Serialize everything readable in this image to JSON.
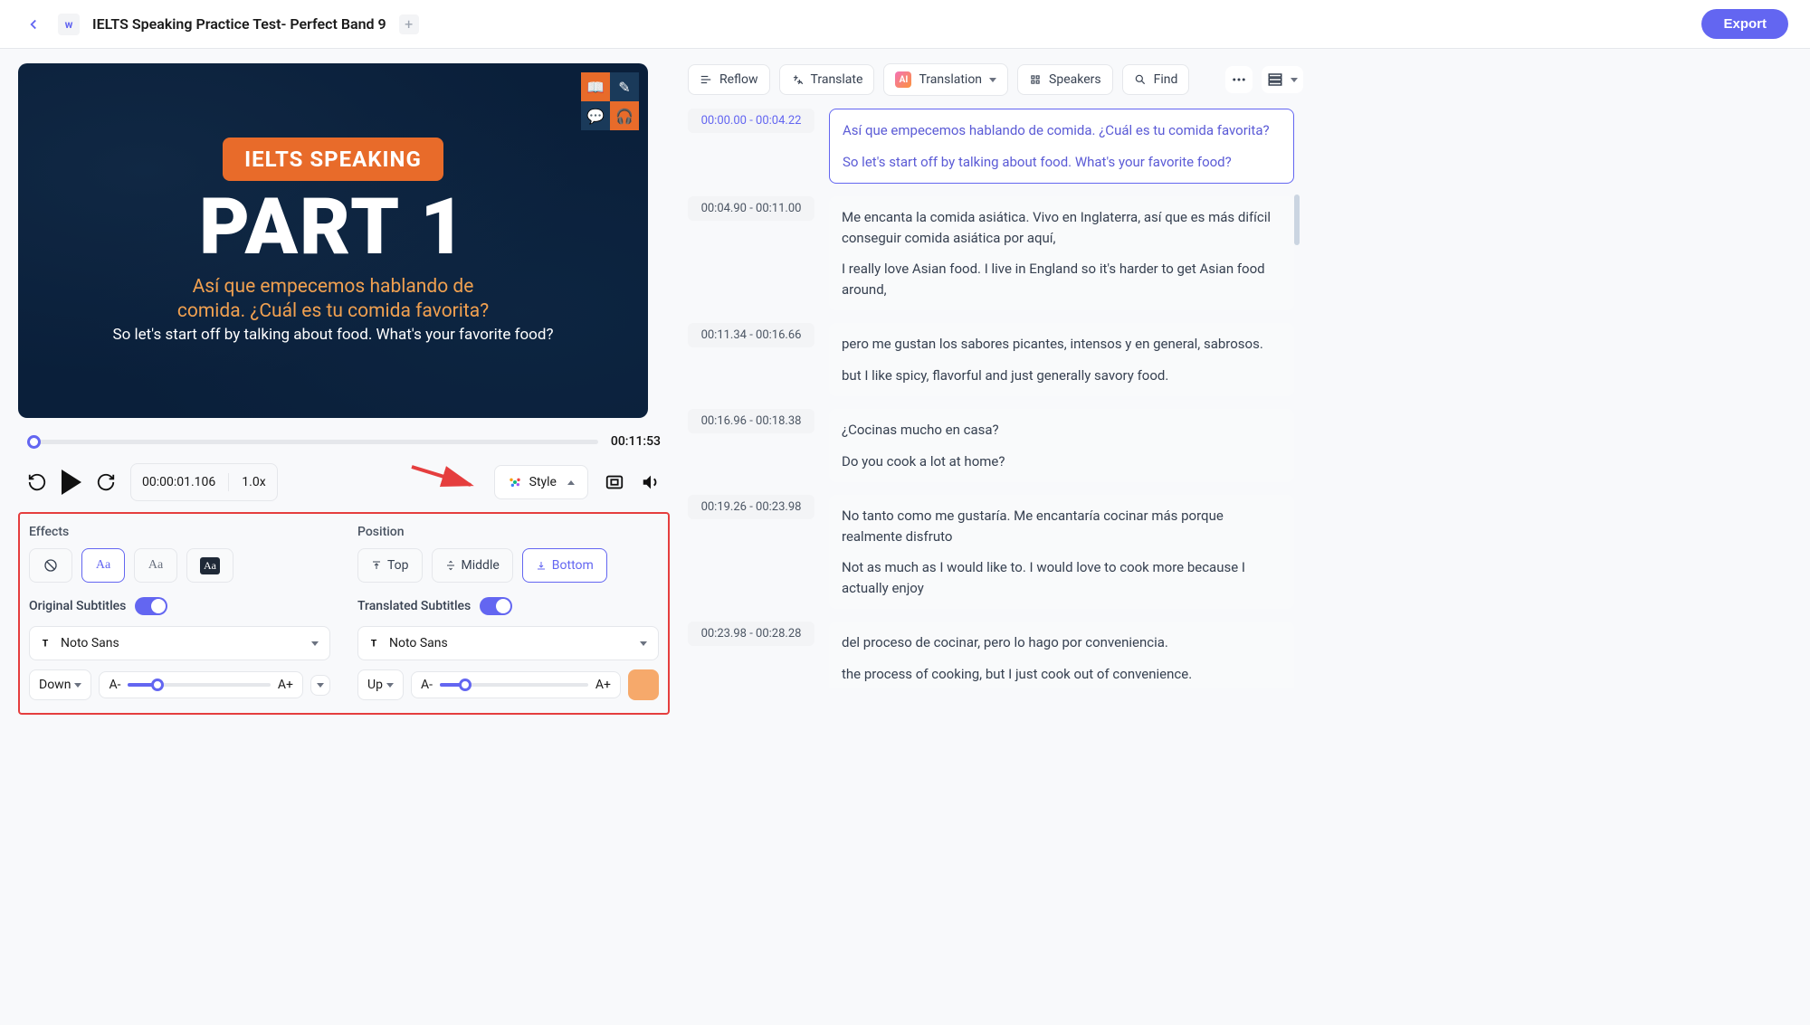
{
  "header": {
    "title": "IELTS Speaking Practice Test- Perfect Band 9",
    "export_label": "Export"
  },
  "video": {
    "pill": "IELTS SPEAKING",
    "big": "PART 1",
    "sub_es_line1": "Así que empecemos hablando de",
    "sub_es_line2": "comida. ¿Cuál es tu comida favorita?",
    "sub_en": "So let's start off by talking about food. What's your favorite food?"
  },
  "player": {
    "total_time": "00:11:53",
    "current_time": "00:00:01.106",
    "speed": "1.0x",
    "style_label": "Style"
  },
  "style_panel": {
    "effects_label": "Effects",
    "position_label": "Position",
    "pos_top": "Top",
    "pos_middle": "Middle",
    "pos_bottom": "Bottom",
    "original_subtitles_label": "Original Subtitles",
    "translated_subtitles_label": "Translated Subtitles",
    "font_original": "Noto Sans",
    "font_translated": "Noto Sans",
    "dir_down": "Down",
    "dir_up": "Up",
    "a_minus": "A-",
    "a_plus": "A+",
    "accent_color": "#f6a96b"
  },
  "toolbar": {
    "reflow": "Reflow",
    "translate": "Translate",
    "translation": "Translation",
    "speakers": "Speakers",
    "find": "Find"
  },
  "segments": [
    {
      "time": "00:00.00 - 00:04.22",
      "trans": "Así que empecemos hablando de comida. ¿Cuál es tu comida favorita?",
      "orig": "So let's start off by talking about food. What's your favorite food?",
      "active": true
    },
    {
      "time": "00:04.90 - 00:11.00",
      "trans": "Me encanta la comida asiática. Vivo en Inglaterra, así que es más difícil conseguir comida asiática por aquí,",
      "orig": "I really love Asian food. I live in England so it's harder to get Asian food around,"
    },
    {
      "time": "00:11.34 - 00:16.66",
      "trans": "pero me gustan los sabores picantes, intensos y en general, sabrosos.",
      "orig": "but I like spicy, flavorful and just generally savory food."
    },
    {
      "time": "00:16.96 - 00:18.38",
      "trans": "¿Cocinas mucho en casa?",
      "orig": "Do you cook a lot at home?"
    },
    {
      "time": "00:19.26 - 00:23.98",
      "trans": "No tanto como me gustaría. Me encantaría cocinar más porque realmente disfruto",
      "orig": "Not as much as I would like to. I would love to cook more because I actually enjoy"
    },
    {
      "time": "00:23.98 - 00:28.28",
      "trans": "del proceso de cocinar, pero lo hago por conveniencia.",
      "orig": "the process of cooking, but I just cook out of convenience."
    }
  ]
}
